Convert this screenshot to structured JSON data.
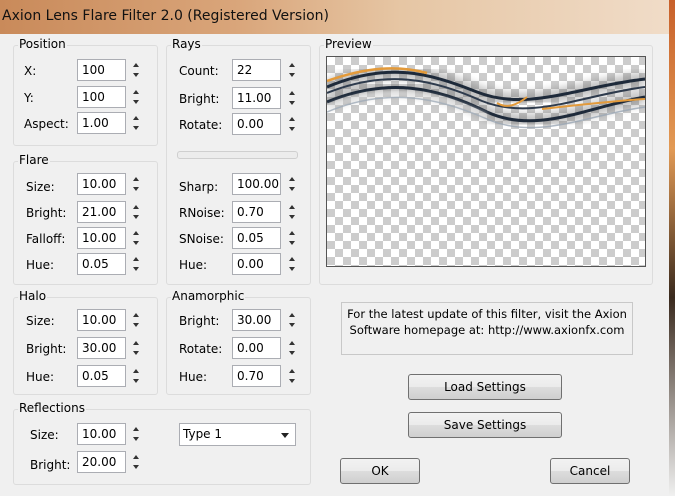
{
  "window": {
    "title": "Axion Lens Flare Filter 2.0 (Registered Version)"
  },
  "position": {
    "label": "Position",
    "x": {
      "label": "X:",
      "value": "100"
    },
    "y": {
      "label": "Y:",
      "value": "100"
    },
    "aspect": {
      "label": "Aspect:",
      "value": "1.00"
    }
  },
  "rays": {
    "label": "Rays",
    "count": {
      "label": "Count:",
      "value": "22"
    },
    "bright": {
      "label": "Bright:",
      "value": "11.00"
    },
    "rotate": {
      "label": "Rotate:",
      "value": "0.00"
    },
    "sharp": {
      "label": "Sharp:",
      "value": "100.00"
    },
    "rnoise": {
      "label": "RNoise:",
      "value": "0.70"
    },
    "snoise": {
      "label": "SNoise:",
      "value": "0.05"
    },
    "hue": {
      "label": "Hue:",
      "value": "0.00"
    }
  },
  "flare": {
    "label": "Flare",
    "size": {
      "label": "Size:",
      "value": "10.00"
    },
    "bright": {
      "label": "Bright:",
      "value": "21.00"
    },
    "falloff": {
      "label": "Falloff:",
      "value": "10.00"
    },
    "hue": {
      "label": "Hue:",
      "value": "0.05"
    }
  },
  "halo": {
    "label": "Halo",
    "size": {
      "label": "Size:",
      "value": "10.00"
    },
    "bright": {
      "label": "Bright:",
      "value": "30.00"
    },
    "hue": {
      "label": "Hue:",
      "value": "0.05"
    }
  },
  "anamorphic": {
    "label": "Anamorphic",
    "bright": {
      "label": "Bright:",
      "value": "30.00"
    },
    "rotate": {
      "label": "Rotate:",
      "value": "0.00"
    },
    "hue": {
      "label": "Hue:",
      "value": "0.70"
    }
  },
  "reflections": {
    "label": "Reflections",
    "size": {
      "label": "Size:",
      "value": "10.00"
    },
    "bright": {
      "label": "Bright:",
      "value": "20.00"
    },
    "type": "Type 1"
  },
  "preview": {
    "label": "Preview"
  },
  "info": {
    "line1": "For the latest update of this filter, visit the Axion",
    "line2": "Software homepage at: http://www.axionfx.com"
  },
  "buttons": {
    "load": "Load Settings",
    "save": "Save Settings",
    "ok": "OK",
    "cancel": "Cancel"
  }
}
